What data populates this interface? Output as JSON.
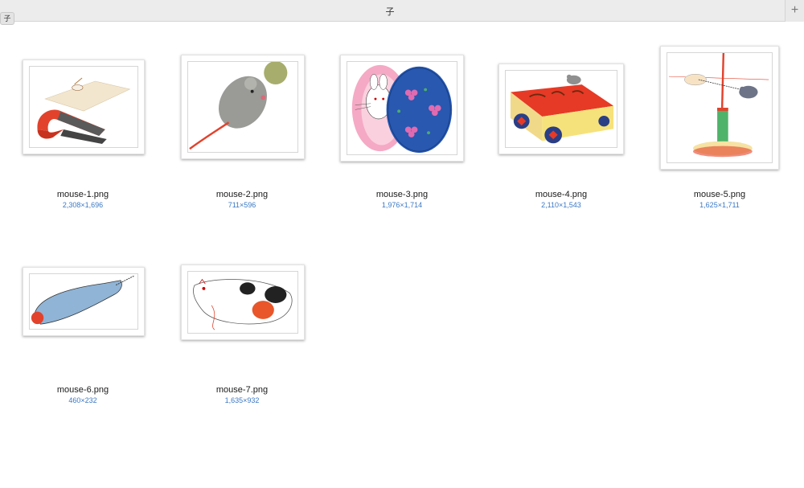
{
  "window": {
    "title": "子",
    "left_badge": "子",
    "add_tab_icon": "plus-icon",
    "add_tab_glyph": "+"
  },
  "files": [
    {
      "name": "mouse-1.png",
      "dimensions": "2,308×1,696"
    },
    {
      "name": "mouse-2.png",
      "dimensions": "711×596"
    },
    {
      "name": "mouse-3.png",
      "dimensions": "1,976×1,714"
    },
    {
      "name": "mouse-4.png",
      "dimensions": "2,110×1,543"
    },
    {
      "name": "mouse-5.png",
      "dimensions": "1,625×1,711"
    },
    {
      "name": "mouse-6.png",
      "dimensions": "460×232"
    },
    {
      "name": "mouse-7.png",
      "dimensions": "1,635×932"
    }
  ],
  "colors": {
    "dimension_text": "#3a78c4",
    "tabbar": "#ececec"
  }
}
